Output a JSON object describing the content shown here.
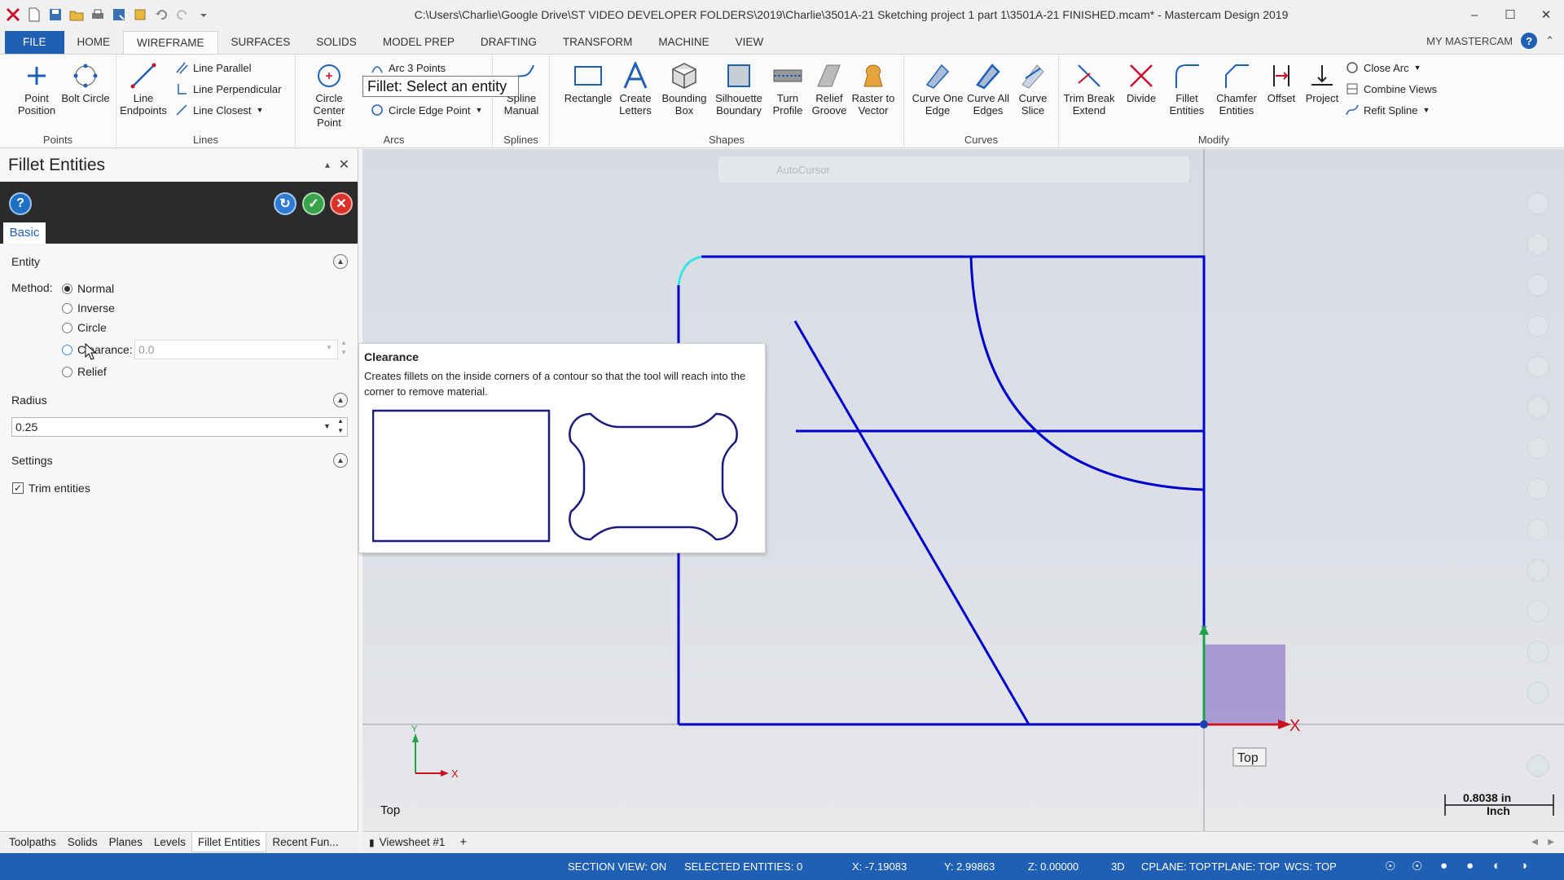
{
  "window": {
    "title": "C:\\Users\\Charlie\\Google Drive\\ST VIDEO DEVELOPER FOLDERS\\2019\\Charlie\\3501A-21 Sketching project 1 part 1\\3501A-21 FINISHED.mcam* - Mastercam Design 2019"
  },
  "ribbon_tabs": [
    "FILE",
    "HOME",
    "WIREFRAME",
    "SURFACES",
    "SOLIDS",
    "MODEL PREP",
    "DRAFTING",
    "TRANSFORM",
    "MACHINE",
    "VIEW"
  ],
  "my_mastercam": "MY MASTERCAM",
  "groups": {
    "points": {
      "label": "Points",
      "point_position": "Point Position",
      "bolt_circle": "Bolt Circle"
    },
    "lines": {
      "label": "Lines",
      "line_endpoints": "Line Endpoints",
      "line_parallel": "Line Parallel",
      "line_perpendicular": "Line Perpendicular",
      "line_closest": "Line Closest"
    },
    "arcs": {
      "label": "Arcs",
      "circle_center_point": "Circle Center Point",
      "arc_3_points": "Arc 3 Points",
      "circle_edge_point": "Circle Edge Point"
    },
    "splines": {
      "label": "Splines",
      "spline_manual": "Spline Manual"
    },
    "shapes": {
      "label": "Shapes",
      "rectangle": "Rectangle",
      "create_letters": "Create Letters",
      "bounding_box": "Bounding Box",
      "silhouette_boundary": "Silhouette Boundary",
      "turn_profile": "Turn Profile",
      "relief_groove": "Relief Groove",
      "raster_to_vector": "Raster to Vector"
    },
    "curves": {
      "label": "Curves",
      "curve_one_edge": "Curve One Edge",
      "curve_all_edges": "Curve All Edges",
      "curve_slice": "Curve Slice"
    },
    "modify": {
      "label": "Modify",
      "trim_break_extend": "Trim Break Extend",
      "divide": "Divide",
      "fillet_entities": "Fillet Entities",
      "chamfer_entities": "Chamfer Entities",
      "offset": "Offset",
      "project": "Project",
      "close_arc": "Close Arc",
      "combine_views": "Combine Views",
      "refit_spline": "Refit Spline"
    }
  },
  "prompt": "Fillet: Select an entity",
  "panel": {
    "title": "Fillet Entities",
    "tab": "Basic",
    "entity_section": "Entity",
    "method_label": "Method:",
    "methods": [
      "Normal",
      "Inverse",
      "Circle",
      "Clearance:",
      "Relief"
    ],
    "clearance_value": "0.0",
    "radius_section": "Radius",
    "radius_value": "0.25",
    "settings_section": "Settings",
    "trim_entities": "Trim entities"
  },
  "tooltip": {
    "title": "Clearance",
    "description": "Creates fillets on the inside corners of a contour so that the tool will reach into the corner to remove material."
  },
  "bottom_tabs": [
    "Toolpaths",
    "Solids",
    "Planes",
    "Levels",
    "Fillet Entities",
    "Recent Fun..."
  ],
  "viewsheet": "Viewsheet #1",
  "viewport": {
    "view_label": "Top",
    "view_badge": "Top",
    "scale_value": "0.8038 in",
    "scale_unit": "Inch",
    "axis_x": "X",
    "axis_y": "Y",
    "autocursor": "AutoCursor"
  },
  "status": {
    "section_view": "SECTION VIEW: ON",
    "selected": "SELECTED ENTITIES: 0",
    "x": "X:  -7.19083",
    "y": "Y:  2.99863",
    "z": "Z:  0.00000",
    "mode": "3D",
    "cplane": "CPLANE: TOP",
    "tplane": "TPLANE: TOP",
    "wcs": "WCS: TOP"
  },
  "colors": {
    "accent": "#1f5fb4",
    "geometry": "#0000cc",
    "fillet_highlight": "#40e0e8"
  }
}
